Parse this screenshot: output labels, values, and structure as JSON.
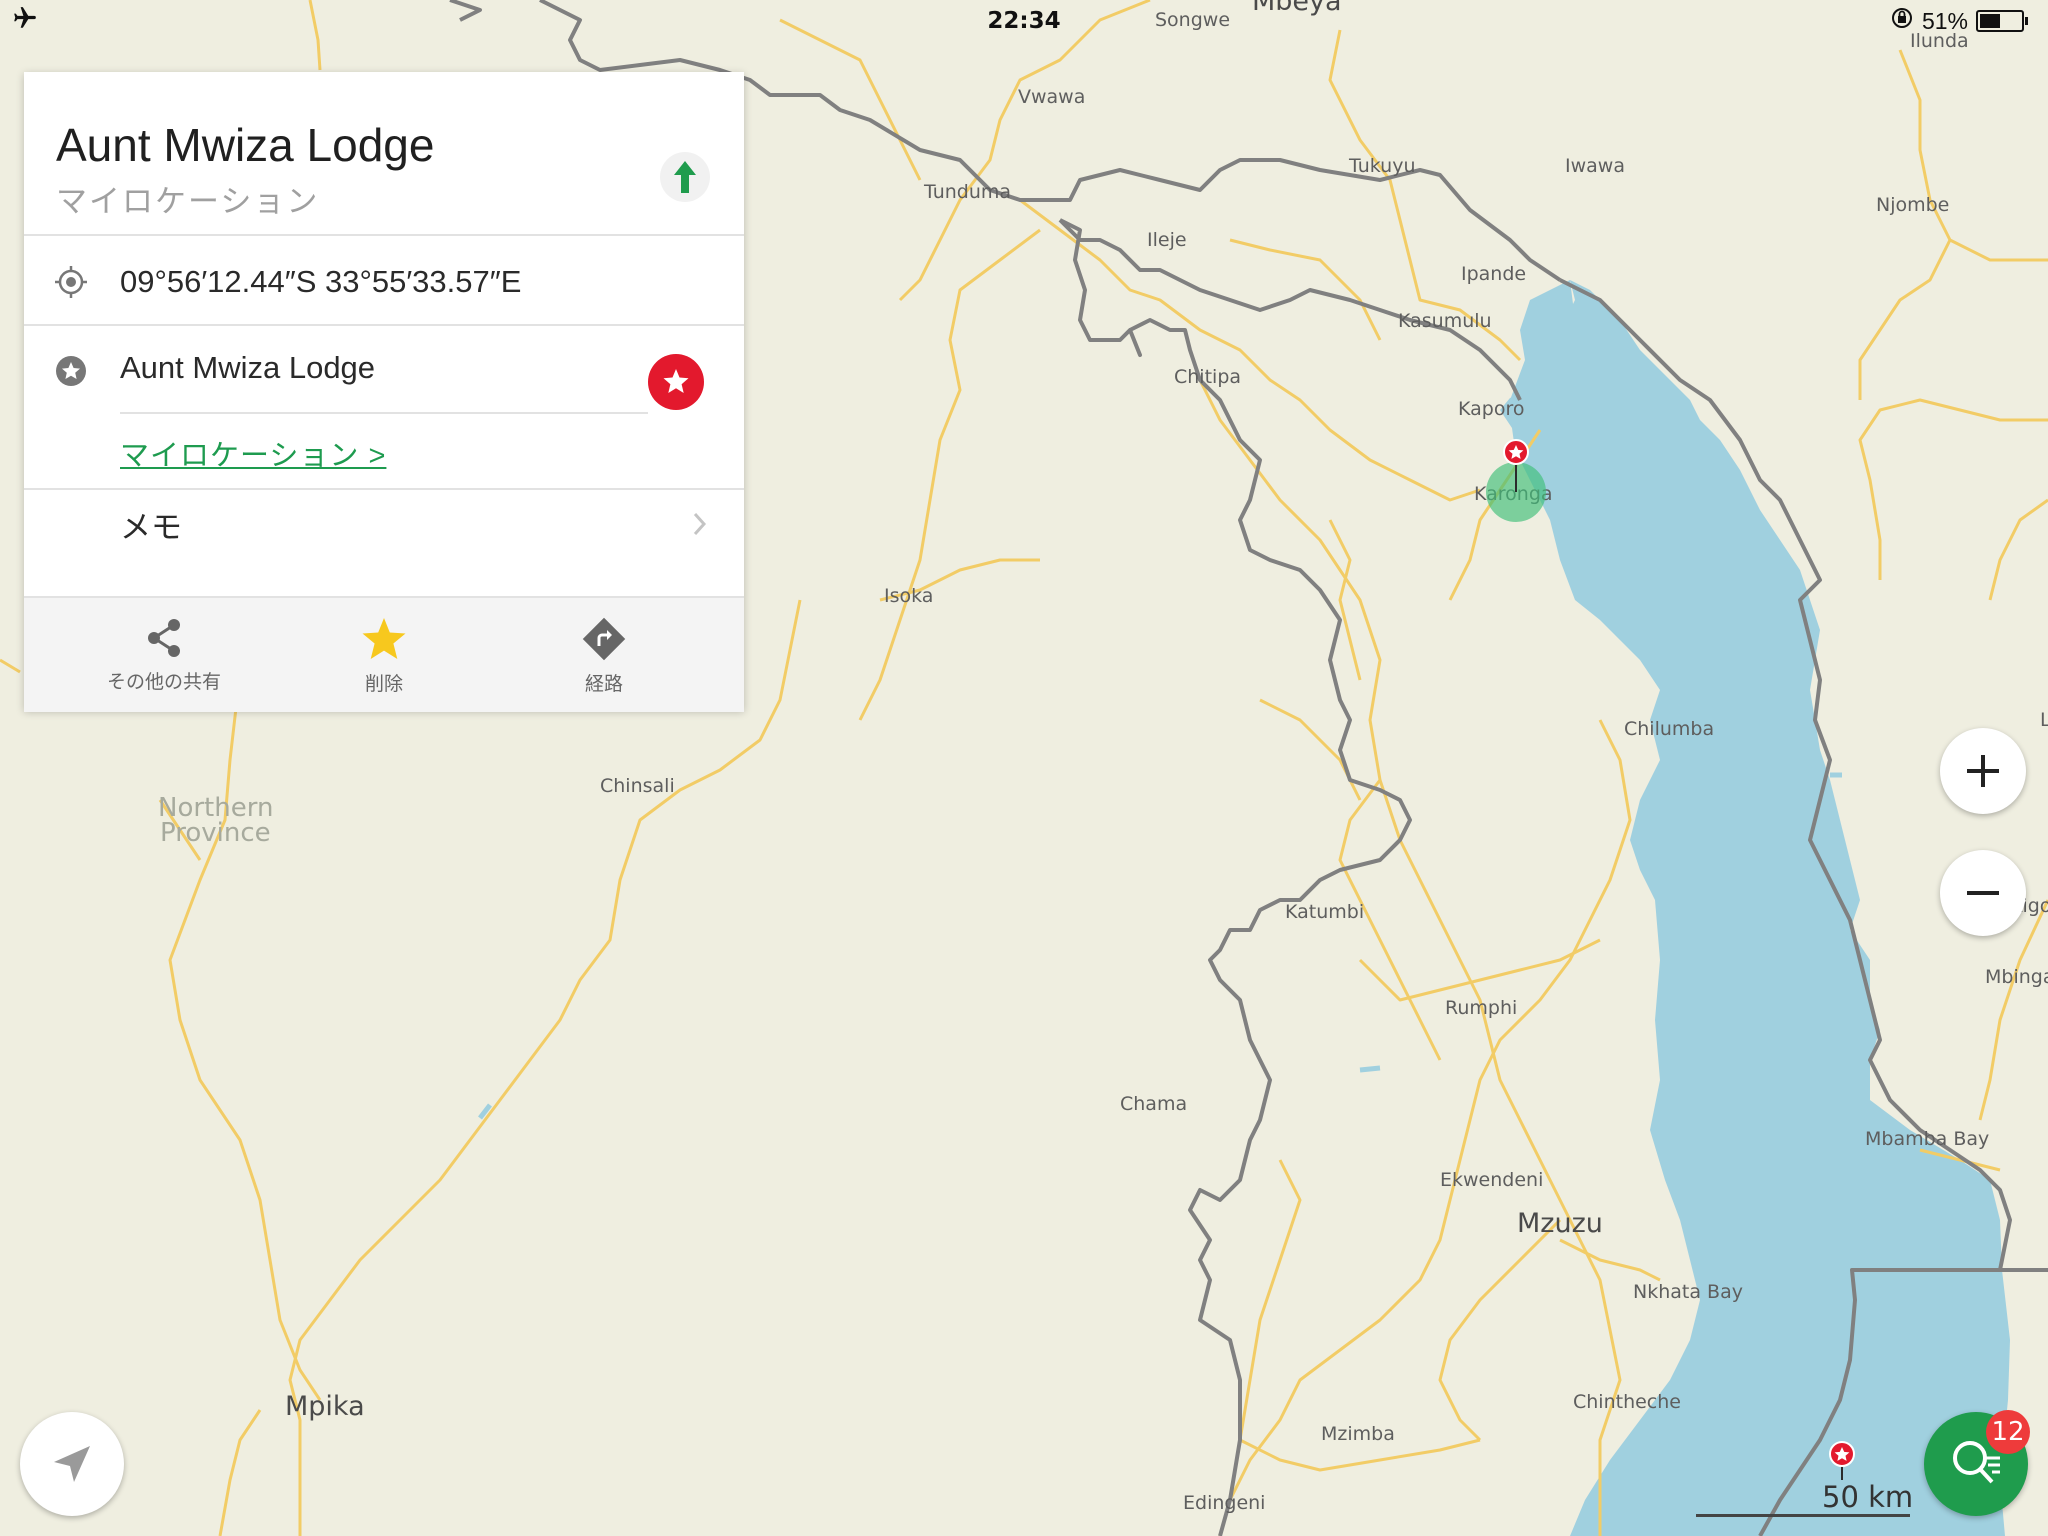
{
  "status_bar": {
    "time": "22:34",
    "battery": "51%",
    "battery_level": 0.51
  },
  "place_card": {
    "title": "Aunt Mwiza Lodge",
    "subtitle": "マイロケーション",
    "coordinates": "09°56′12.44″S 33°55′33.57″E",
    "bookmark_name": "Aunt Mwiza Lodge",
    "category_link": "マイロケーション >",
    "memo_label": "メモ",
    "actions": [
      {
        "label": "その他の共有",
        "icon": "share-icon"
      },
      {
        "label": "削除",
        "icon": "star-icon"
      },
      {
        "label": "経路",
        "icon": "route-icon"
      }
    ],
    "accent_color": "#1e9b4f",
    "favorite_color": "#e3192d"
  },
  "map": {
    "labels": {
      "songwe": "Songwe",
      "mbeya": "Mbeya",
      "ilunda": "Ilunda",
      "vwawa": "Vwawa",
      "tukuyu": "Tukuyu",
      "iwawa": "Iwawa",
      "njombe": "Njombe",
      "tunduma": "Tunduma",
      "ileje": "Ileje",
      "ipande": "Ipande",
      "kasumulu": "Kasumulu",
      "chitipa": "Chitipa",
      "kaporo": "Kaporo",
      "karonga": "Karonga",
      "isoka": "Isoka",
      "chilumba": "Chilumba",
      "chinsali": "Chinsali",
      "northern": "Northern",
      "province": "Province",
      "katumbi": "Katumbi",
      "kigo": "Kigo",
      "mbinga": "Mbinga",
      "rumphi": "Rumphi",
      "chama": "Chama",
      "mbamba_bay": "Mbamba Bay",
      "ekwendeni": "Ekwendeni",
      "mzuzu": "Mzuzu",
      "nkhata_bay": "Nkhata Bay",
      "mpika": "Mpika",
      "chintheche": "Chintheche",
      "mzimba": "Mzimba",
      "edingeni": "Edingeni",
      "l_edge": "L"
    },
    "scale_label": "50 km",
    "results_badge": "12",
    "water_color": "#a0d0df",
    "land_color": "#efeee0",
    "road_color": "#f2cc66",
    "border_color": "#808080"
  }
}
